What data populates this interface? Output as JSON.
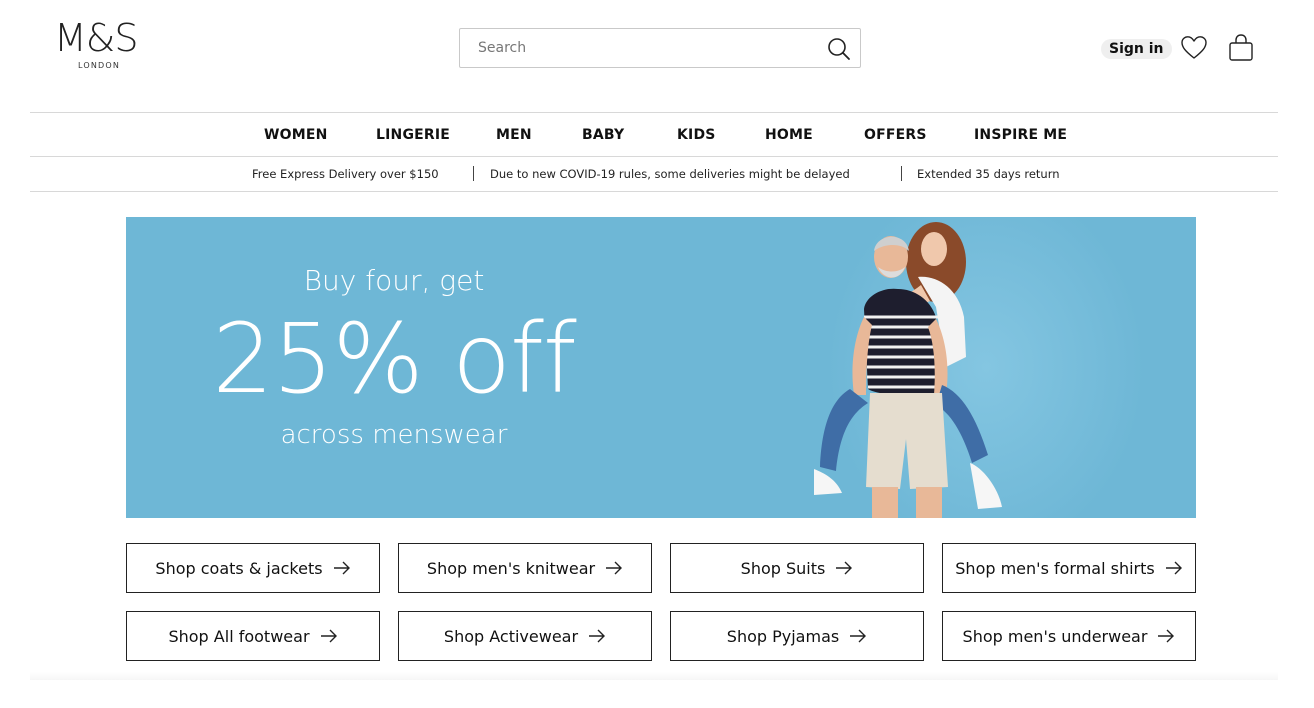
{
  "header": {
    "logo_text": "M&S",
    "logo_sub": "LONDON",
    "search_placeholder": "Search",
    "sign_in": "Sign in"
  },
  "nav": {
    "items": [
      "WOMEN",
      "LINGERIE",
      "MEN",
      "BABY",
      "KIDS",
      "HOME",
      "OFFERS",
      "INSPIRE ME"
    ]
  },
  "info_bar": {
    "messages": [
      "Free Express Delivery over $150",
      "Due to new COVID-19 rules, some deliveries might be delayed",
      "Extended 35 days return"
    ]
  },
  "banner": {
    "line1": "Buy four, get",
    "line2": "25% off",
    "line3": "across menswear",
    "bg_color": "#6eb7d6"
  },
  "shop_buttons": [
    "Shop coats & jackets",
    "Shop men's knitwear",
    "Shop Suits",
    "Shop men's formal shirts",
    "Shop All footwear",
    "Shop Activewear",
    "Shop Pyjamas",
    "Shop men's underwear"
  ],
  "icons": {
    "search": "search-icon",
    "wishlist": "heart-icon",
    "bag": "shopping-bag-icon",
    "arrow": "arrow-right-icon"
  }
}
